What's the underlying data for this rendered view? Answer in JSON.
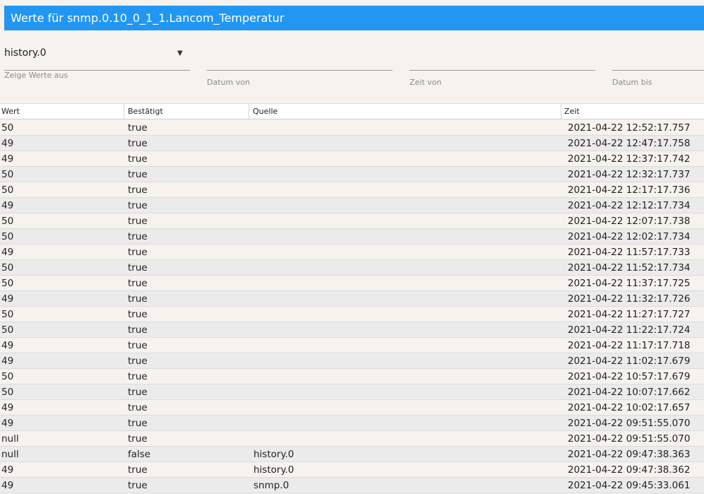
{
  "title": "Werte für snmp.0.10_0_1_1.Lancom_Temperatur",
  "filters": {
    "instance_value": "history.0",
    "instance_label": "Zeige Werte aus",
    "date_from_label": "Datum von",
    "time_from_label": "Zeit von",
    "date_to_label": "Datum bis"
  },
  "columns": [
    "Wert",
    "Bestätigt",
    "Quelle",
    "Zeit"
  ],
  "rows": [
    {
      "wert": "50",
      "bestaetigt": "true",
      "quelle": "",
      "zeit": "2021-04-22 12:52:17.757"
    },
    {
      "wert": "49",
      "bestaetigt": "true",
      "quelle": "",
      "zeit": "2021-04-22 12:47:17.758"
    },
    {
      "wert": "49",
      "bestaetigt": "true",
      "quelle": "",
      "zeit": "2021-04-22 12:37:17.742"
    },
    {
      "wert": "50",
      "bestaetigt": "true",
      "quelle": "",
      "zeit": "2021-04-22 12:32:17.737"
    },
    {
      "wert": "50",
      "bestaetigt": "true",
      "quelle": "",
      "zeit": "2021-04-22 12:17:17.736"
    },
    {
      "wert": "49",
      "bestaetigt": "true",
      "quelle": "",
      "zeit": "2021-04-22 12:12:17.734"
    },
    {
      "wert": "50",
      "bestaetigt": "true",
      "quelle": "",
      "zeit": "2021-04-22 12:07:17.738"
    },
    {
      "wert": "50",
      "bestaetigt": "true",
      "quelle": "",
      "zeit": "2021-04-22 12:02:17.734"
    },
    {
      "wert": "49",
      "bestaetigt": "true",
      "quelle": "",
      "zeit": "2021-04-22 11:57:17.733"
    },
    {
      "wert": "50",
      "bestaetigt": "true",
      "quelle": "",
      "zeit": "2021-04-22 11:52:17.734"
    },
    {
      "wert": "50",
      "bestaetigt": "true",
      "quelle": "",
      "zeit": "2021-04-22 11:37:17.725"
    },
    {
      "wert": "49",
      "bestaetigt": "true",
      "quelle": "",
      "zeit": "2021-04-22 11:32:17.726"
    },
    {
      "wert": "50",
      "bestaetigt": "true",
      "quelle": "",
      "zeit": "2021-04-22 11:27:17.727"
    },
    {
      "wert": "50",
      "bestaetigt": "true",
      "quelle": "",
      "zeit": "2021-04-22 11:22:17.724"
    },
    {
      "wert": "49",
      "bestaetigt": "true",
      "quelle": "",
      "zeit": "2021-04-22 11:17:17.718"
    },
    {
      "wert": "49",
      "bestaetigt": "true",
      "quelle": "",
      "zeit": "2021-04-22 11:02:17.679"
    },
    {
      "wert": "50",
      "bestaetigt": "true",
      "quelle": "",
      "zeit": "2021-04-22 10:57:17.679"
    },
    {
      "wert": "50",
      "bestaetigt": "true",
      "quelle": "",
      "zeit": "2021-04-22 10:07:17.662"
    },
    {
      "wert": "49",
      "bestaetigt": "true",
      "quelle": "",
      "zeit": "2021-04-22 10:02:17.657"
    },
    {
      "wert": "49",
      "bestaetigt": "true",
      "quelle": "",
      "zeit": "2021-04-22 09:51:55.070"
    },
    {
      "wert": "null",
      "bestaetigt": "true",
      "quelle": "",
      "zeit": "2021-04-22 09:51:55.070"
    },
    {
      "wert": "null",
      "bestaetigt": "false",
      "quelle": "history.0",
      "zeit": "2021-04-22 09:47:38.363"
    },
    {
      "wert": "49",
      "bestaetigt": "true",
      "quelle": "history.0",
      "zeit": "2021-04-22 09:47:38.362"
    },
    {
      "wert": "49",
      "bestaetigt": "true",
      "quelle": "snmp.0",
      "zeit": "2021-04-22 09:45:33.061"
    }
  ]
}
